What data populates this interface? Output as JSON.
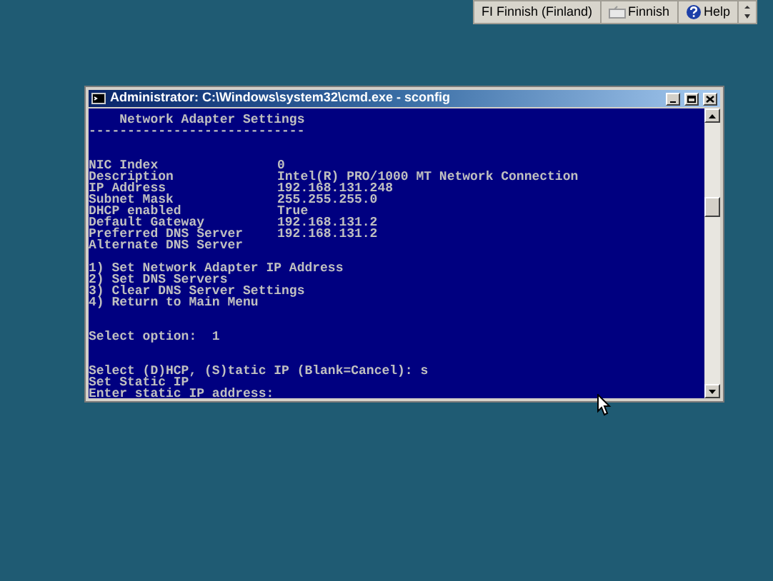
{
  "language_bar": {
    "items": [
      {
        "kind": "text",
        "label": "FI  Finnish (Finland)"
      },
      {
        "kind": "keyboard",
        "label": "Finnish"
      },
      {
        "kind": "help",
        "label": "Help"
      }
    ]
  },
  "window": {
    "title": "Administrator: C:\\Windows\\system32\\cmd.exe - sconfig"
  },
  "console": {
    "heading": "    Network Adapter Settings",
    "rule": "----------------------------",
    "fields": [
      {
        "label": "NIC Index",
        "value": "0"
      },
      {
        "label": "Description",
        "value": "Intel(R) PRO/1000 MT Network Connection"
      },
      {
        "label": "IP Address",
        "value": "192.168.131.248"
      },
      {
        "label": "Subnet Mask",
        "value": "255.255.255.0"
      },
      {
        "label": "DHCP enabled",
        "value": "True"
      },
      {
        "label": "Default Gateway",
        "value": "192.168.131.2"
      },
      {
        "label": "Preferred DNS Server",
        "value": "192.168.131.2"
      },
      {
        "label": "Alternate DNS Server"
      }
    ],
    "menu": [
      "1) Set Network Adapter IP Address",
      "2) Set DNS Servers",
      "3) Clear DNS Server Settings",
      "4) Return to Main Menu"
    ],
    "select_prompt": "Select option:  1",
    "output": [
      "Select (D)HCP, (S)tatic IP (Blank=Cancel): s",
      "Set Static IP",
      "Enter static IP address:"
    ]
  }
}
